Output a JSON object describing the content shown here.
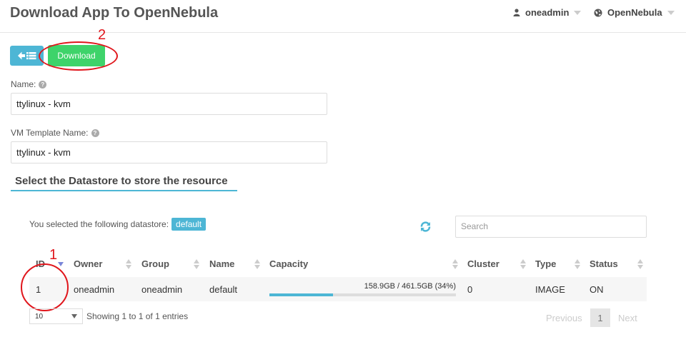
{
  "header": {
    "title": "Download App To OpenNebula",
    "user": "oneadmin",
    "zone": "OpenNebula"
  },
  "toolbar": {
    "download_label": "Download"
  },
  "annotations": {
    "first": "1",
    "second": "2",
    "color": "#e0161c"
  },
  "form": {
    "name_label": "Name:",
    "name_value": "ttylinux - kvm",
    "template_label": "VM Template Name:",
    "template_value": "ttylinux - kvm"
  },
  "datastore": {
    "section_title": "Select the Datastore to store the resource",
    "selection_text": "You selected the following datastore:",
    "selected": "default",
    "search_placeholder": "Search",
    "columns": [
      "ID",
      "Owner",
      "Group",
      "Name",
      "Capacity",
      "Cluster",
      "Type",
      "Status"
    ],
    "rows": [
      {
        "id": "1",
        "owner": "oneadmin",
        "group": "oneadmin",
        "name": "default",
        "capacity": "158.9GB / 461.5GB (34%)",
        "capacity_fraction": 0.34,
        "cluster": "0",
        "type": "IMAGE",
        "status": "ON"
      }
    ],
    "page_length": "10",
    "entries_info": "Showing 1 to 1 of 1 entries",
    "previous_label": "Previous",
    "current_page": "1",
    "next_label": "Next"
  },
  "colors": {
    "accent": "#4db6d5",
    "download": "#3ed36a"
  }
}
